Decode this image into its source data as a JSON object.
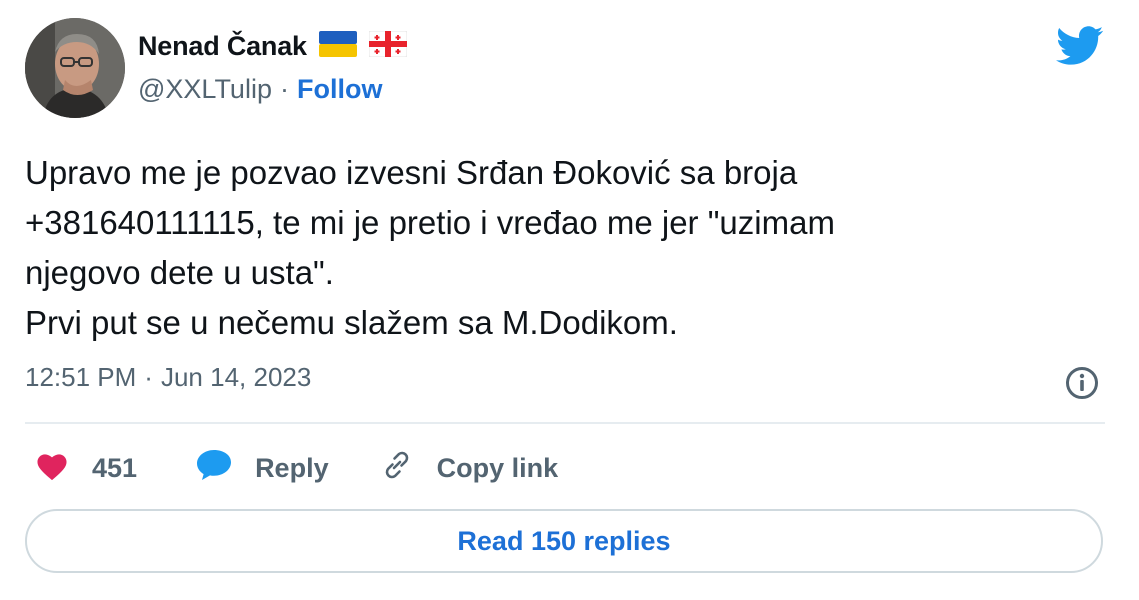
{
  "author": {
    "display_name": "Nenad Čanak",
    "handle": "@XXLTulip",
    "separator": "·",
    "follow_label": "Follow",
    "flags": [
      "ukraine-flag-icon",
      "georgia-flag-icon"
    ]
  },
  "tweet": {
    "lines": [
      "Upravo me je pozvao izvesni Srđan Đoković sa broja",
      "+381640111115, te mi je pretio i vređao me jer \"uzimam",
      "njegovo dete u usta\".",
      "Prvi put se u nečemu slažem sa M.Dodikom."
    ],
    "time": "12:51 PM",
    "date": "Jun 14, 2023",
    "time_separator": "·"
  },
  "actions": {
    "like_count": "451",
    "reply_label": "Reply",
    "copy_link_label": "Copy link",
    "read_replies_label": "Read 150 replies"
  },
  "colors": {
    "heart": "#e0245e",
    "reply_bubble": "#1d9bf0",
    "link": "#1d70d6",
    "twitter_blue": "#1d9bf0",
    "secondary_text": "#536471"
  },
  "icons": {
    "brand": "twitter-bird-icon",
    "like": "heart-icon",
    "reply": "speech-bubble-icon",
    "copy": "link-icon",
    "info": "info-icon"
  }
}
